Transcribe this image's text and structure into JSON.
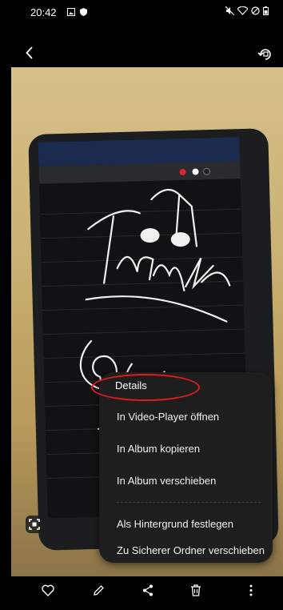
{
  "status_bar": {
    "time": "20:42",
    "right_icons": [
      "mute-icon",
      "wifi-icon",
      "dnd-icon",
      "battery-icon"
    ]
  },
  "top_bar": {
    "back_icon": "chevron-left-icon",
    "action_icon": "rotate-icon"
  },
  "photo": {
    "description_text": ""
  },
  "context_menu": {
    "items": [
      {
        "label": "Details"
      },
      {
        "label": "In Video-Player öffnen"
      },
      {
        "label": "In Album kopieren"
      },
      {
        "label": "In Album verschieben"
      },
      {
        "label": "Als Hintergrund festlegen"
      },
      {
        "label": "Zu Sicherer Ordner verschieben"
      }
    ]
  },
  "bottom_bar": {
    "icons": [
      "heart-icon",
      "edit-icon",
      "share-icon",
      "delete-icon",
      "more-icon"
    ]
  },
  "colors": {
    "highlight": "#e21b1b",
    "menu_bg": "#1e1e1f"
  }
}
